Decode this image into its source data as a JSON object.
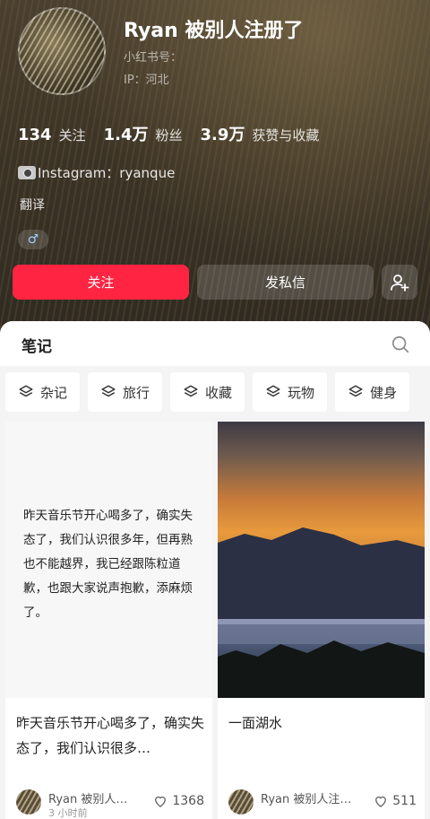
{
  "profile": {
    "username": "Ryan 被别人注册了",
    "id_label": "小红书号：",
    "ip_label": "IP：河北",
    "gender_symbol": "♂",
    "bio": "Instagram：ryanque",
    "translate": "翻译"
  },
  "stats": [
    {
      "num": "134",
      "label": "关注"
    },
    {
      "num": "1.4万",
      "label": "粉丝"
    },
    {
      "num": "3.9万",
      "label": "获赞与收藏"
    }
  ],
  "actions": {
    "follow": "关注",
    "message": "发私信",
    "add_user_icon": "add-user-icon"
  },
  "tabs": {
    "notes": "笔记"
  },
  "categories": [
    "杂记",
    "旅行",
    "收藏",
    "玩物",
    "健身"
  ],
  "posts": [
    {
      "cover_text": "昨天音乐节开心喝多了，确实失态了，我们认识很多年，但再熟也不能越界，我已经跟陈粒道歉，也跟大家说声抱歉，添麻烦了。",
      "title": "昨天音乐节开心喝多了，确实失态了，我们认识很多…",
      "author": "Ryan 被别人…",
      "time": "3 小时前",
      "likes": "1368"
    },
    {
      "title": "一面湖水",
      "author": "Ryan 被别人注…",
      "likes": "511"
    }
  ],
  "colors": {
    "accent": "#ff2442"
  }
}
